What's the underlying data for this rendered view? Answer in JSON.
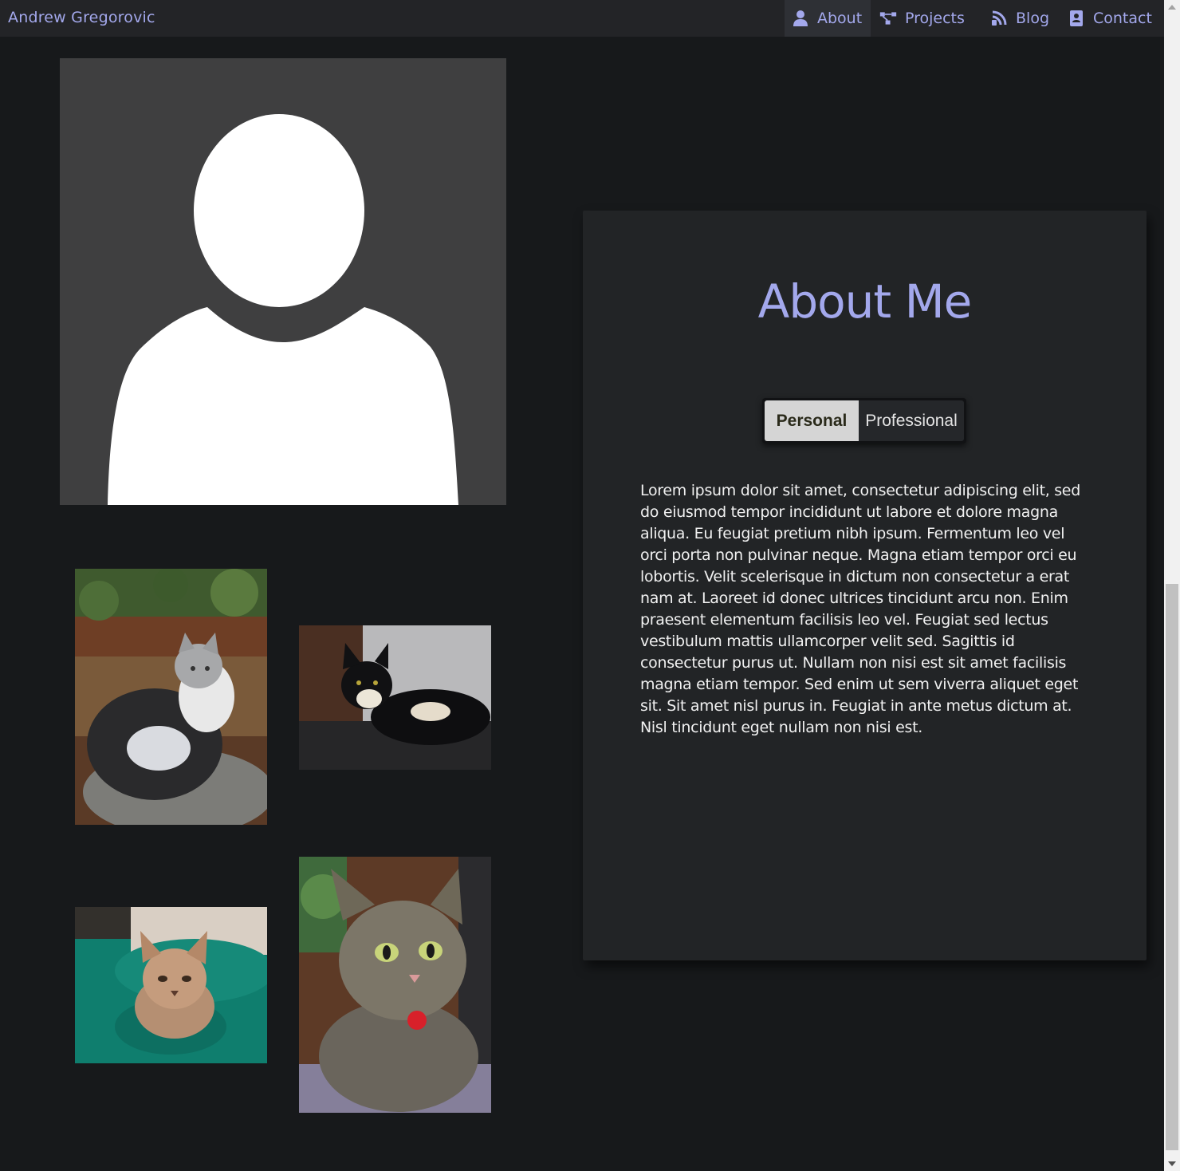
{
  "navbar": {
    "brand": "Andrew Gregorovic",
    "items": [
      {
        "label": "About",
        "icon": "user-icon",
        "active": true
      },
      {
        "label": "Projects",
        "icon": "diagram-icon",
        "active": false
      },
      {
        "label": "Blog",
        "icon": "blog-icon",
        "active": false
      },
      {
        "label": "Contact",
        "icon": "contact-card-icon",
        "active": false
      }
    ]
  },
  "about": {
    "title": "About Me",
    "tabs": {
      "personal": "Personal",
      "professional": "Professional"
    },
    "selected_tab": "Personal",
    "bio": "Lorem ipsum dolor sit amet, consectetur adipiscing elit, sed do eiusmod tempor incididunt ut labore et dolore magna aliqua. Eu feugiat pretium nibh ipsum. Fermentum leo vel orci porta non pulvinar neque. Magna etiam tempor orci eu lobortis. Velit scelerisque in dictum non consectetur a erat nam at. Laoreet id donec ultrices tincidunt arcu non. Enim praesent elementum facilisis leo vel. Feugiat sed lectus vestibulum mattis ullamcorper velit sed. Sagittis id consectetur purus ut. Nullam non nisi est sit amet facilisis magna etiam tempor. Sed enim ut sem viverra aliquet eget sit. Sit amet nisl purus in. Feugiat in ante metus dictum at. Nisl tincidunt eget nullam non nisi est."
  },
  "colors": {
    "accent": "#a3a8ec",
    "background": "#17191b",
    "navbar": "#232427",
    "card": "#222426"
  }
}
